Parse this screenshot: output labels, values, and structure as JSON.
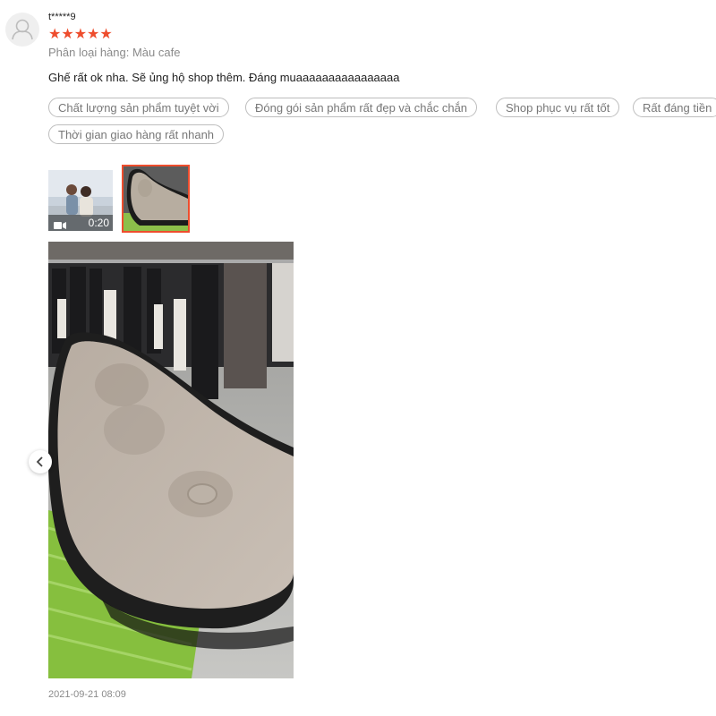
{
  "review": {
    "username": "t*****9",
    "rating": 5,
    "stars": [
      "★",
      "★",
      "★",
      "★",
      "★"
    ],
    "variation": "Phân loại hàng: Màu cafe",
    "comment": "Ghế rất ok nha. Sẽ ủng hộ shop thêm. Đáng muaaaaaaaaaaaaaaaa",
    "tags": [
      "Chất lượng sản phẩm tuyệt vời",
      "Đóng gói sản phẩm rất đẹp và chắc chắn",
      "Shop phục vụ rất tốt",
      "Rất đáng tiền",
      "Thời gian giao hàng rất nhanh"
    ],
    "video_duration": "0:20",
    "timestamp": "2021-09-21 08:09"
  },
  "colors": {
    "star": "#ee4d2d",
    "selected_border": "#ee4d2d",
    "tag_border": "#bdbdbd",
    "muted_text": "#8a8a8a"
  },
  "icons": {
    "avatar": "user-silhouette-icon",
    "video": "video-camera-icon",
    "prev": "chevron-left-icon"
  }
}
